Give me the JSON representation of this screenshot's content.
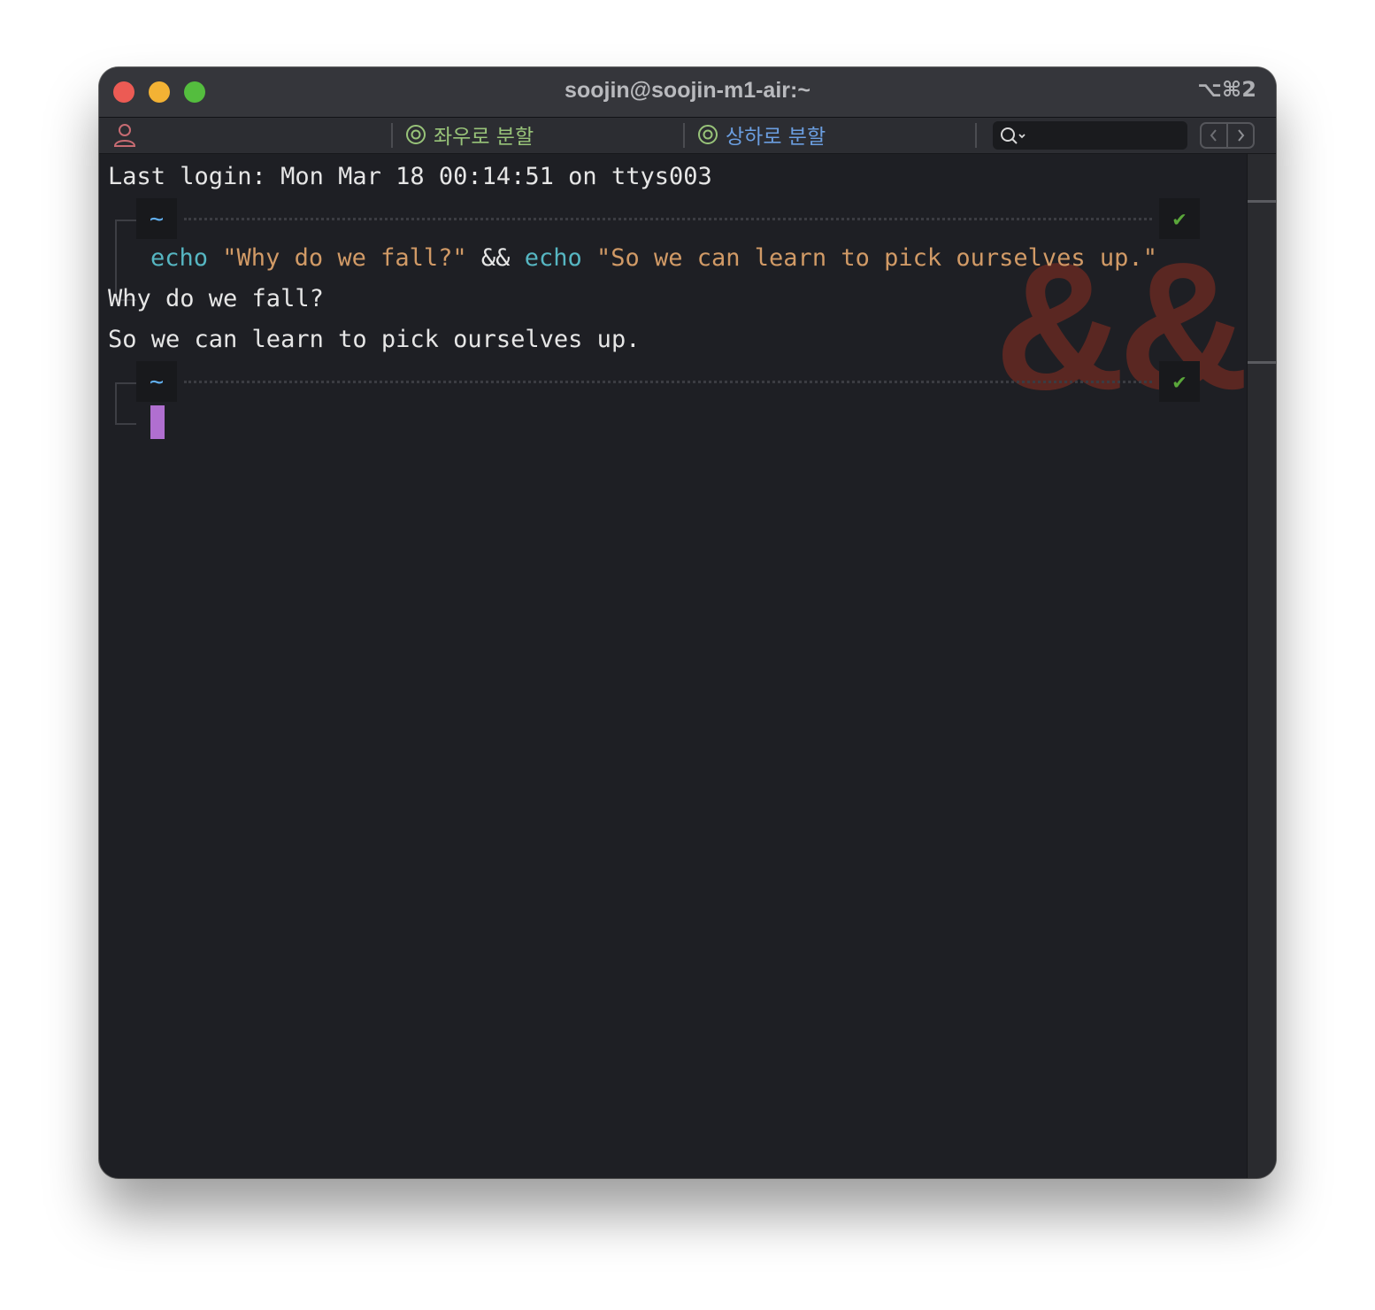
{
  "window": {
    "title": "soojin@soojin-m1-air:~",
    "shortcut": "⌥⌘2"
  },
  "toolbar": {
    "profile_icon": "person-icon",
    "split_left_right_label": "좌우로 분할",
    "split_top_bottom_label": "상하로 분할",
    "search_icon": "search-icon",
    "search_value": "",
    "nav_prev_icon": "chevron-left-icon",
    "nav_next_icon": "chevron-right-icon"
  },
  "terminal": {
    "last_login": "Last login: Mon Mar 18 00:14:51 on ttys003",
    "prompt1": {
      "dir": "~",
      "status": "✔"
    },
    "command": {
      "cmd1": "echo",
      "arg1": "\"Why do we fall?\"",
      "op": "&&",
      "cmd2": "echo",
      "arg2": "\"So we can learn to pick ourselves up.\""
    },
    "output": [
      "Why do we fall?",
      "So we can learn to pick ourselves up."
    ],
    "prompt2": {
      "dir": "~",
      "status": "✔"
    },
    "watermark": "&&"
  },
  "colors": {
    "command": "#56b6c2",
    "string": "#d19a66",
    "prompt_dir": "#61afef",
    "status_ok": "#5aa73a",
    "cursor": "#b06fd0",
    "split_lr": "#98c379",
    "split_tb": "#6b9ee0"
  }
}
